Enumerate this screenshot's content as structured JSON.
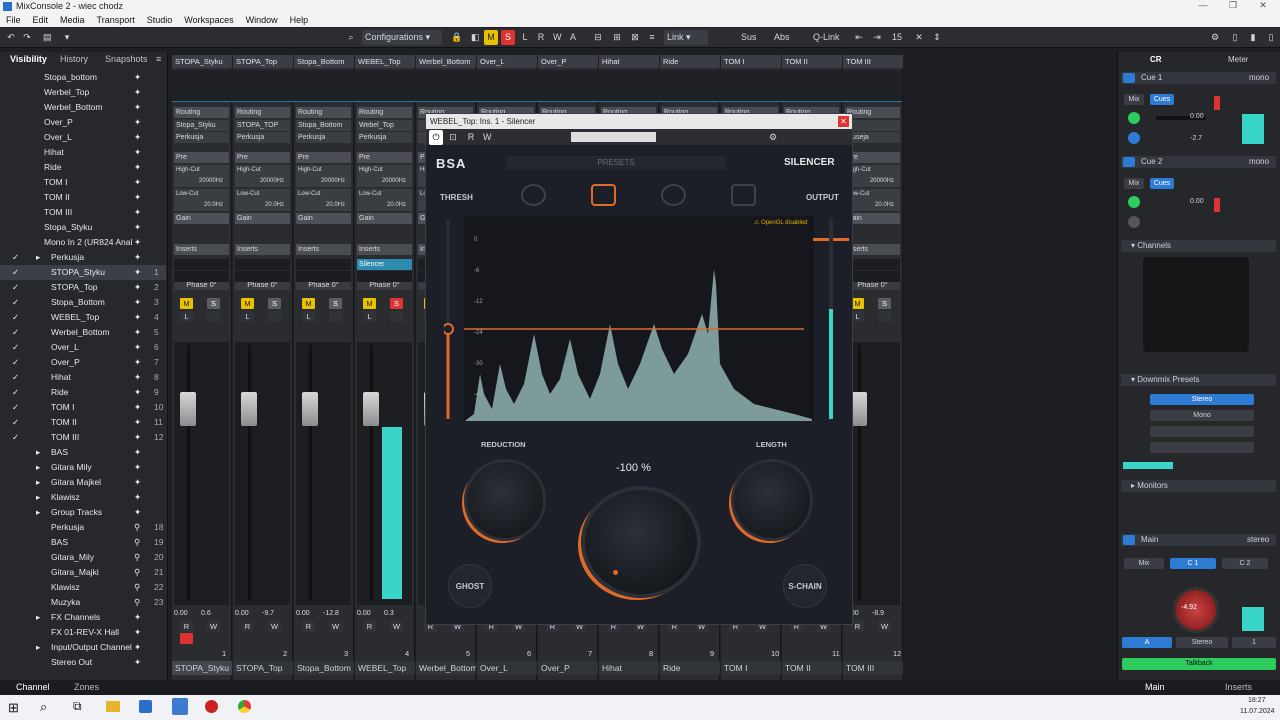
{
  "window": {
    "title": "MixConsole 2 - wiec chodz"
  },
  "menu": [
    "File",
    "Edit",
    "Media",
    "Transport",
    "Studio",
    "Workspaces",
    "Window",
    "Help"
  ],
  "toolbar": {
    "configurations": "Configurations",
    "link": "Link",
    "sus": "Sus",
    "abs": "Abs",
    "qlink": "Q-Link",
    "count": "15",
    "m": "M",
    "s": "S",
    "l": "L",
    "r": "R",
    "w": "W",
    "a": "A"
  },
  "left_tabs": {
    "visibility": "Visibility",
    "history": "History",
    "snapshots": "Snapshots",
    "channel": "Channel",
    "zones": "Zones"
  },
  "visibility_items": [
    {
      "name": "Stopa_bottom",
      "num": ""
    },
    {
      "name": "Werbel_Top",
      "num": ""
    },
    {
      "name": "Werbel_Bottom",
      "num": ""
    },
    {
      "name": "Over_P",
      "num": ""
    },
    {
      "name": "Over_L",
      "num": ""
    },
    {
      "name": "Hihat",
      "num": ""
    },
    {
      "name": "Ride",
      "num": ""
    },
    {
      "name": "TOM I",
      "num": ""
    },
    {
      "name": "TOM II",
      "num": ""
    },
    {
      "name": "TOM III",
      "num": ""
    },
    {
      "name": "Stopa_Styku",
      "num": ""
    },
    {
      "name": "Mono In 2 (UR824 Anal",
      "num": ""
    },
    {
      "name": "Perkusja",
      "num": ""
    },
    {
      "name": "STOPA_Styku",
      "num": "1"
    },
    {
      "name": "STOPA_Top",
      "num": "2"
    },
    {
      "name": "Stopa_Bottom",
      "num": "3"
    },
    {
      "name": "WEBEL_Top",
      "num": "4"
    },
    {
      "name": "Werbel_Bottom",
      "num": "5"
    },
    {
      "name": "Over_L",
      "num": "6"
    },
    {
      "name": "Over_P",
      "num": "7"
    },
    {
      "name": "Hihat",
      "num": "8"
    },
    {
      "name": "Ride",
      "num": "9"
    },
    {
      "name": "TOM I",
      "num": "10"
    },
    {
      "name": "TOM II",
      "num": "11"
    },
    {
      "name": "TOM III",
      "num": "12"
    },
    {
      "name": "BAS",
      "num": ""
    },
    {
      "name": "Gitara Mily",
      "num": ""
    },
    {
      "name": "Gitara Majkel",
      "num": ""
    },
    {
      "name": "Klawisz",
      "num": ""
    },
    {
      "name": "Group Tracks",
      "num": ""
    },
    {
      "name": "Perkusja",
      "num": "18"
    },
    {
      "name": "BAS",
      "num": "19"
    },
    {
      "name": "Gitara_Mily",
      "num": "20"
    },
    {
      "name": "Gitara_Majki",
      "num": "21"
    },
    {
      "name": "Klawisz",
      "num": "22"
    },
    {
      "name": "Muzyka",
      "num": "23"
    },
    {
      "name": "FX Channels",
      "num": ""
    },
    {
      "name": "FX 01-REV-X Hall",
      "num": ""
    },
    {
      "name": "Input/Output Channel",
      "num": ""
    },
    {
      "name": "Stereo Out",
      "num": ""
    }
  ],
  "channels": [
    {
      "name": "STOPA_Styku",
      "route1": "Stopa_Styku",
      "route2": "Perkusja",
      "vol": "0.00",
      "pan": "0.6",
      "num": "1",
      "bottom": "STOPA_Styku"
    },
    {
      "name": "STOPA_Top",
      "route1": "STOPA_TOP",
      "route2": "Perkusja",
      "vol": "0.00",
      "pan": "-9.7",
      "num": "2",
      "bottom": "STOPA_Top"
    },
    {
      "name": "Stopa_Bottom",
      "route1": "Stopa_Bottom",
      "route2": "Perkusja",
      "vol": "0.00",
      "pan": "-12.8",
      "num": "3",
      "bottom": "Stopa_Bottom"
    },
    {
      "name": "WEBEL_Top",
      "route1": "Webel_Top",
      "route2": "Perkusja",
      "vol": "0.00",
      "pan": "0.3",
      "num": "4",
      "bottom": "WEBEL_Top"
    },
    {
      "name": "Werbel_Bottom",
      "num": "5",
      "bottom": "Werbel_Bottom"
    },
    {
      "name": "Over_L",
      "num": "6",
      "bottom": "Over_L"
    },
    {
      "name": "Over_P",
      "num": "7",
      "bottom": "Over_P"
    },
    {
      "name": "Hihat",
      "num": "8",
      "bottom": "Hihat"
    },
    {
      "name": "Ride",
      "num": "9",
      "bottom": "Ride"
    },
    {
      "name": "TOM I",
      "num": "10",
      "bottom": "TOM I"
    },
    {
      "name": "TOM II",
      "num": "11",
      "bottom": "TOM II"
    },
    {
      "name": "TOM III",
      "route1": "",
      "route2": "Ruseja",
      "vol": "0.00",
      "pan": "-8.9",
      "num": "12",
      "bottom": "TOM III"
    }
  ],
  "strip_labels": {
    "routing": "Routing",
    "pre": "Pre",
    "highcut": "High-Cut",
    "highcut_val": "20000Hz",
    "lowcut": "Low-Cut",
    "lowcut_val": "20.0Hz",
    "gain": "Gain",
    "phase": "Phase 0°",
    "inserts": "Inserts",
    "insert_plugin": "Silencer",
    "m": "M",
    "s": "S",
    "l": "L",
    "r": "R",
    "w": "W",
    "c": "C"
  },
  "plugin": {
    "title": "WEBEL_Top: Ins. 1 - Silencer",
    "brand": "BSA",
    "presets": "PRESETS",
    "product": "SILENCER",
    "thresh": "THRESH",
    "output": "OUTPUT",
    "opengl": "OpenGL disabled",
    "reduction": "REDUCTION",
    "length": "LENGTH",
    "main_value": "-100 %",
    "ghost": "GHOST",
    "schain": "S-CHAIN",
    "scale": [
      "0",
      "-6",
      "-12",
      "-18",
      "-24",
      "-30",
      "-36",
      "-48"
    ]
  },
  "right_panel": {
    "tab_cr": "CR",
    "tab_meter": "Meter",
    "cue1": "Cue 1",
    "cue2": "Cue 2",
    "mono": "mono",
    "mix": "Mix",
    "cues": "Cues",
    "val1": "0.00",
    "val2": "-2.7",
    "channels": "Channels",
    "downmix": "Downmix Presets",
    "stereo": "Stereo",
    "mono_preset": "Mono",
    "monitors": "Monitors",
    "main": "Main",
    "stereo_tag": "stereo",
    "c1": "C 1",
    "c2": "C 2",
    "main_val": "-4.92",
    "a": "A",
    "stereo_btn": "Stereo",
    "one": "1",
    "talkback": "Talkback",
    "tab_main": "Main",
    "tab_inserts": "Inserts"
  },
  "taskbar": {
    "time": "18:27",
    "date": "11.07.2024"
  },
  "colors": {
    "accent_orange": "#e06a2a",
    "meter_cyan": "#38d5c8",
    "cue_blue": "#2e7bd6",
    "talkback_green": "#2ecc5e"
  }
}
